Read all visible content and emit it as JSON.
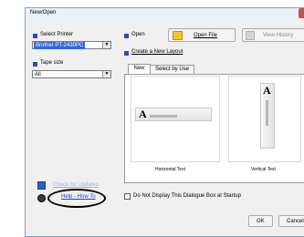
{
  "window": {
    "title": "New/Open"
  },
  "printer": {
    "label": "Select Printer",
    "value": "Brother PT-2430PC"
  },
  "tape": {
    "label": "Tape size",
    "value": "All"
  },
  "open": {
    "label": "Open",
    "open_file_button": "Open File",
    "view_history_button": "View History"
  },
  "create": {
    "label": "Create a New Layout"
  },
  "tabs": [
    {
      "label": "New"
    },
    {
      "label": "Select by Use"
    }
  ],
  "layouts": [
    {
      "caption": "Horizontal Text",
      "glyph": "A"
    },
    {
      "caption": "Vertical Text",
      "glyph": "A"
    }
  ],
  "help": {
    "partial_link": "Check for Updates",
    "link": "Help - How To"
  },
  "checkbox": {
    "label": "Do Not Display This Dialogue Box at Startup"
  },
  "buttons": {
    "ok": "OK",
    "cancel": "Cancel"
  },
  "colors": {
    "accent": "#2c47c8",
    "link": "#1a3fd6",
    "selection": "#3168d5"
  }
}
